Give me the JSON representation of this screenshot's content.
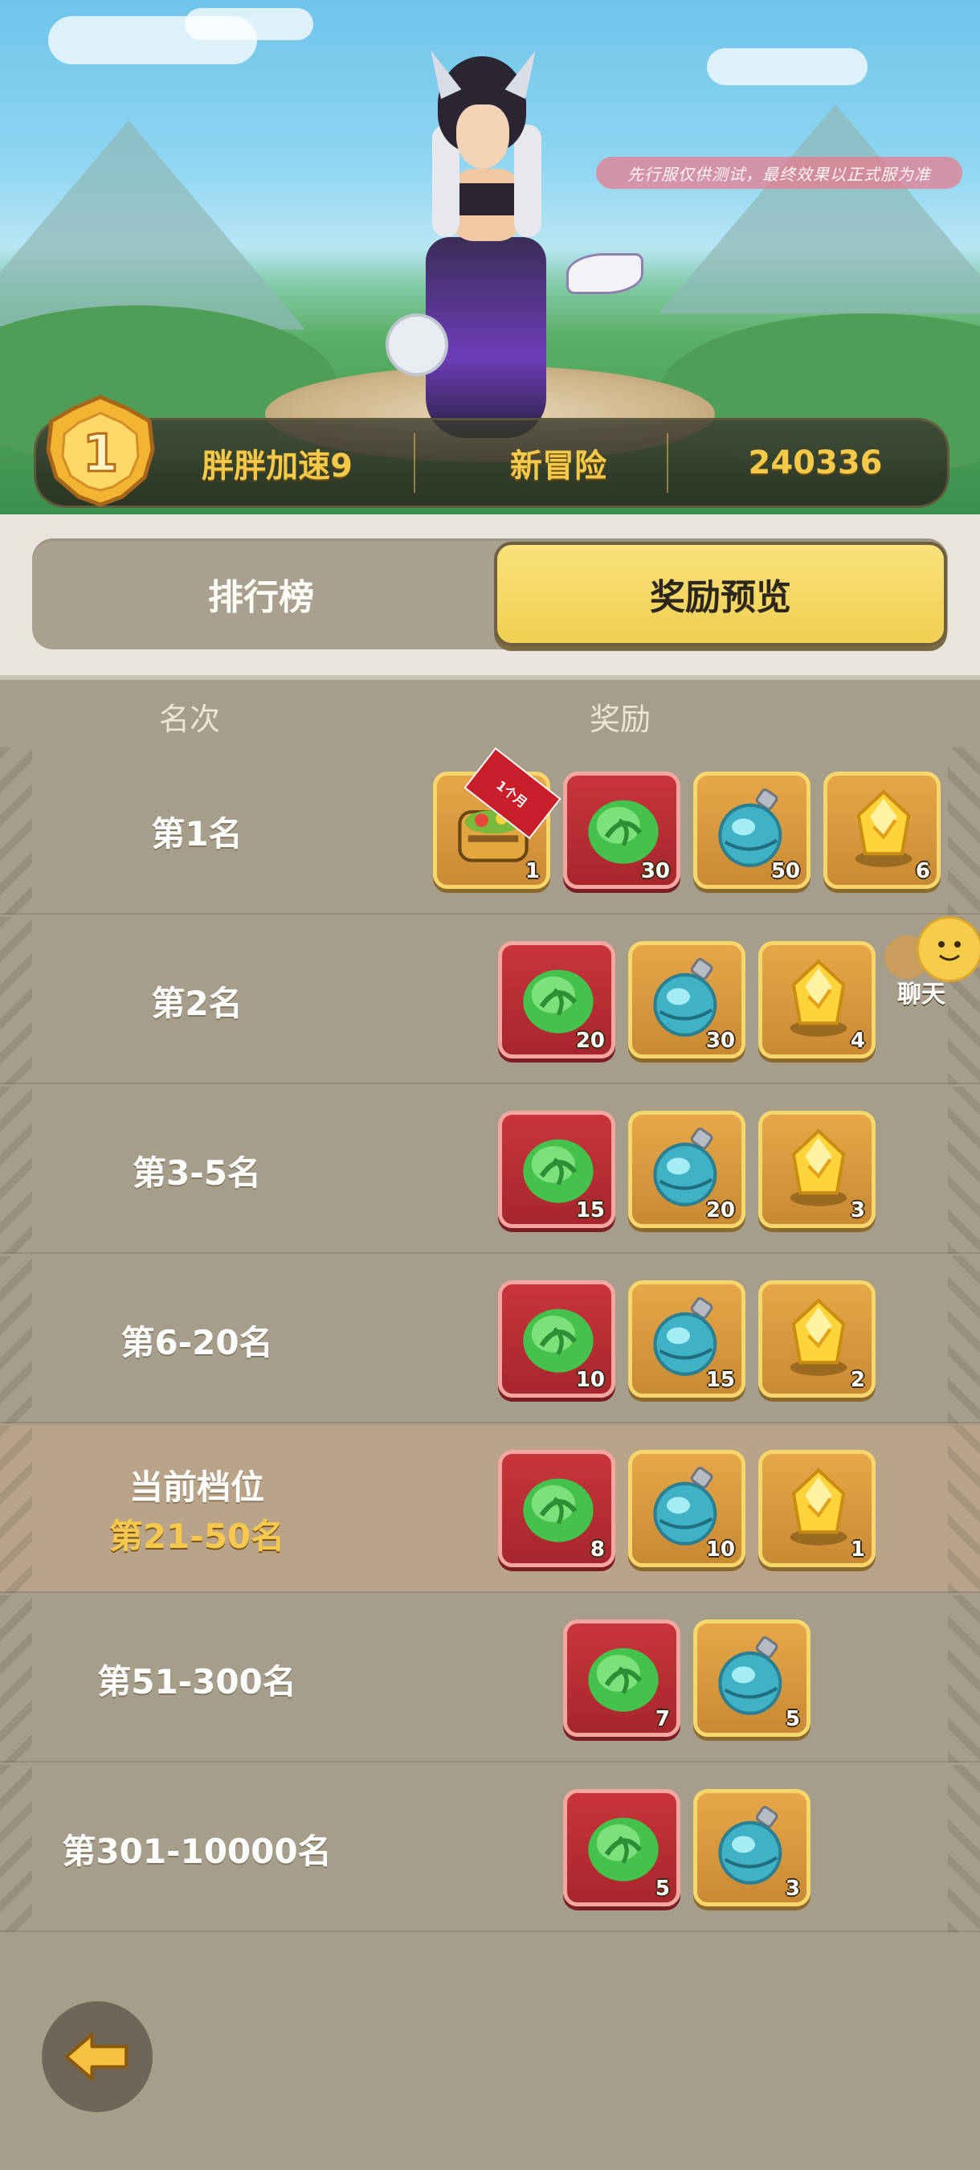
{
  "notice": "先行服仅供测试，最终效果以正式服为准",
  "topRank": {
    "rank": "1",
    "player": "胖胖加速9",
    "mode": "新冒险",
    "score": "240336"
  },
  "tabs": {
    "leaderboard": "排行榜",
    "rewards": "奖励预览",
    "active": "rewards"
  },
  "table": {
    "col_rank": "名次",
    "col_reward": "奖励"
  },
  "rows": [
    {
      "label": "第1名",
      "rewards": [
        {
          "type": "chest",
          "count": "1",
          "badge": "1个月"
        },
        {
          "type": "cabbage",
          "count": "30"
        },
        {
          "type": "potion",
          "count": "50"
        },
        {
          "type": "crystal",
          "count": "6"
        }
      ]
    },
    {
      "label": "第2名",
      "rewards": [
        {
          "type": "cabbage",
          "count": "20"
        },
        {
          "type": "potion",
          "count": "30"
        },
        {
          "type": "crystal",
          "count": "4"
        }
      ]
    },
    {
      "label": "第3-5名",
      "rewards": [
        {
          "type": "cabbage",
          "count": "15"
        },
        {
          "type": "potion",
          "count": "20"
        },
        {
          "type": "crystal",
          "count": "3"
        }
      ]
    },
    {
      "label": "第6-20名",
      "rewards": [
        {
          "type": "cabbage",
          "count": "10"
        },
        {
          "type": "potion",
          "count": "15"
        },
        {
          "type": "crystal",
          "count": "2"
        }
      ]
    },
    {
      "label": "当前档位",
      "sublabel": "第21-50名",
      "current": true,
      "rewards": [
        {
          "type": "cabbage",
          "count": "8"
        },
        {
          "type": "potion",
          "count": "10"
        },
        {
          "type": "crystal",
          "count": "1"
        }
      ]
    },
    {
      "label": "第51-300名",
      "rewards": [
        {
          "type": "cabbage",
          "count": "7"
        },
        {
          "type": "potion",
          "count": "5"
        }
      ]
    },
    {
      "label": "第301-10000名",
      "rewards": [
        {
          "type": "cabbage",
          "count": "5"
        },
        {
          "type": "potion",
          "count": "3"
        }
      ]
    }
  ],
  "chat": {
    "label": "聊天"
  },
  "colors": {
    "gold_text": "#f5c94a",
    "active_tab": "#f0cf52",
    "panel": "#a79d8b"
  }
}
